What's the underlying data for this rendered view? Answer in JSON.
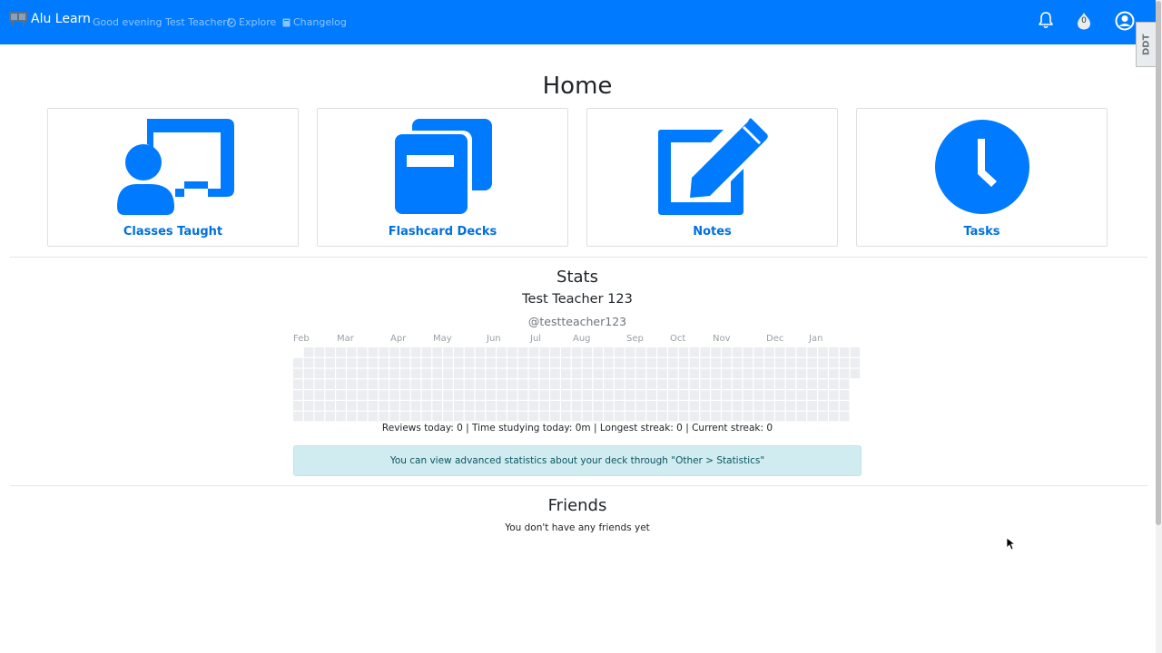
{
  "app": {
    "brand": "Alu Learn",
    "greeting": "Good evening Test Teacher!"
  },
  "nav": {
    "links": [
      {
        "label": "Explore"
      },
      {
        "label": "Changelog"
      }
    ],
    "notification_count": "0",
    "devtool_badge": "DDT"
  },
  "page": {
    "title": "Home"
  },
  "cards": [
    {
      "label": "Classes Taught",
      "icon": "chalkboard-teacher-icon"
    },
    {
      "label": "Flashcard Decks",
      "icon": "card-stack-icon"
    },
    {
      "label": "Notes",
      "icon": "edit-note-icon"
    },
    {
      "label": "Tasks",
      "icon": "clock-icon"
    }
  ],
  "stats": {
    "title": "Stats",
    "name": "Test Teacher 123",
    "username": "@testteacher123",
    "months": [
      "Feb",
      "Mar",
      "Apr",
      "May",
      "Jun",
      "Jul",
      "Aug",
      "Sep",
      "Oct",
      "Nov",
      "Dec",
      "Jan"
    ],
    "summary": "Reviews today: 0 | Time studying today: 0m | Longest streak: 0 | Current streak: 0",
    "info": "You can view advanced statistics about your deck through \"Other > Statistics\""
  },
  "friends": {
    "title": "Friends",
    "empty": "You don't have any friends yet"
  },
  "colors": {
    "primary": "#007bff",
    "card_label": "#0070e0",
    "heat_empty": "#ebedf0",
    "alert_bg": "#d1ecf1"
  }
}
